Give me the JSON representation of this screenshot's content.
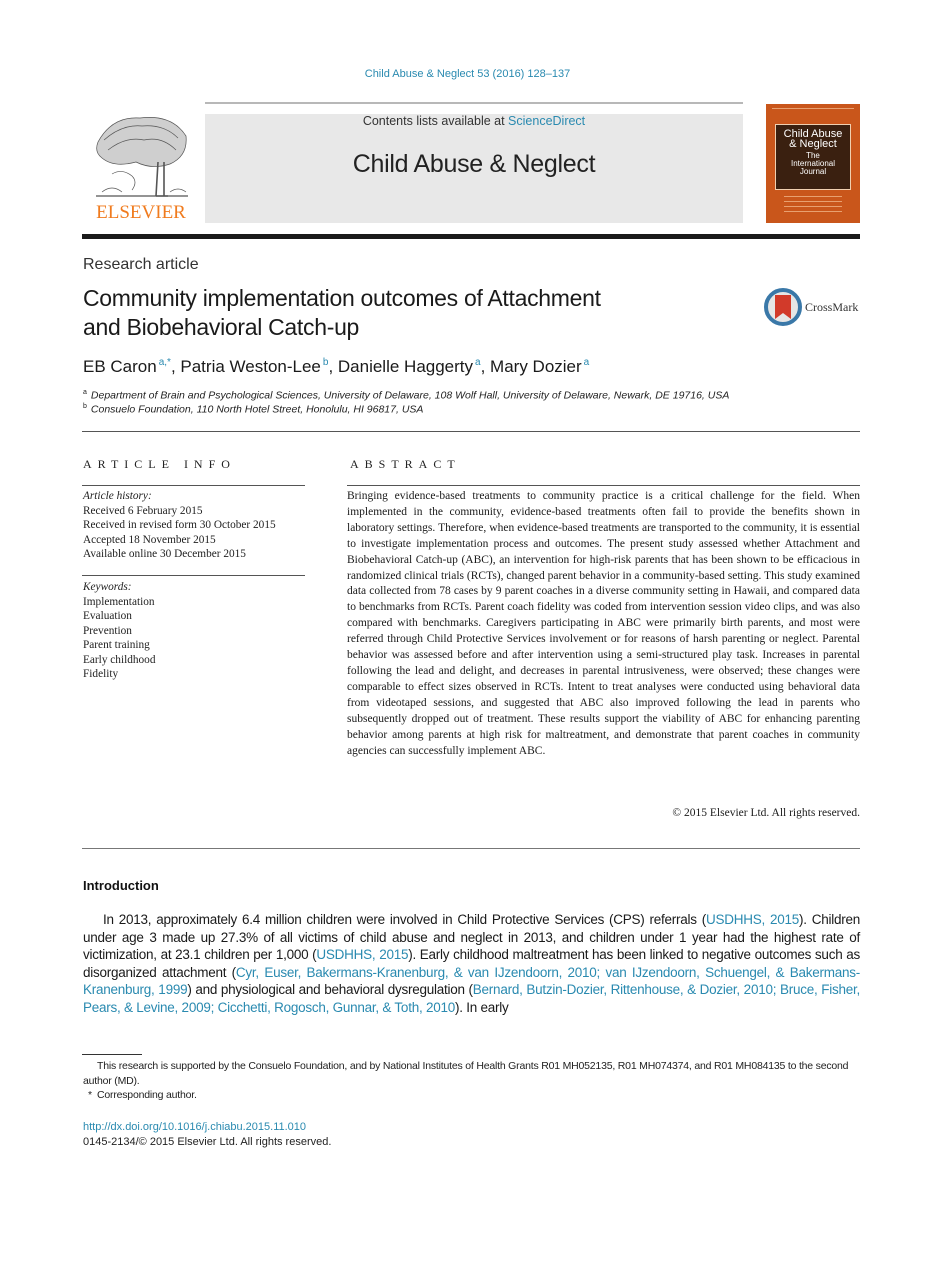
{
  "journal_ref": "Child Abuse & Neglect 53 (2016) 128–137",
  "masthead": {
    "contents_prefix": "Contents lists available at ",
    "contents_link": "ScienceDirect",
    "journal_title": "Child Abuse & Neglect",
    "publisher_logo_text": "ELSEVIER"
  },
  "cover": {
    "line1": "Child Abuse",
    "line2": "& Neglect",
    "line3": "The",
    "line4": "International",
    "line5": "Journal",
    "color": "#c9561b"
  },
  "article": {
    "type": "Research article",
    "title_line1": "Community implementation outcomes of Attachment",
    "title_line2": "and Biobehavioral Catch-up",
    "crossmark_label": "CrossMark",
    "authors": [
      {
        "name": "EB Caron",
        "sup": "a,*"
      },
      {
        "name": "Patria Weston-Lee",
        "sup": "b"
      },
      {
        "name": "Danielle Haggerty",
        "sup": "a"
      },
      {
        "name": "Mary Dozier",
        "sup": "a"
      }
    ],
    "affiliations": [
      {
        "mark": "a",
        "text": "Department of Brain and Psychological Sciences, University of Delaware, 108 Wolf Hall, University of Delaware, Newark, DE 19716, USA"
      },
      {
        "mark": "b",
        "text": "Consuelo Foundation, 110 North Hotel Street, Honolulu, HI 96817, USA"
      }
    ]
  },
  "article_info": {
    "heading": "ARTICLE INFO",
    "history_label": "Article history:",
    "history": [
      "Received 6 February 2015",
      "Received in revised form 30 October 2015",
      "Accepted 18 November 2015",
      "Available online 30 December 2015"
    ],
    "keywords_label": "Keywords:",
    "keywords": [
      "Implementation",
      "Evaluation",
      "Prevention",
      "Parent training",
      "Early childhood",
      "Fidelity"
    ]
  },
  "abstract": {
    "heading": "ABSTRACT",
    "text": "Bringing evidence-based treatments to community practice is a critical challenge for the field. When implemented in the community, evidence-based treatments often fail to provide the benefits shown in laboratory settings. Therefore, when evidence-based treatments are transported to the community, it is essential to investigate implementation process and outcomes. The present study assessed whether Attachment and Biobehavioral Catch-up (ABC), an intervention for high-risk parents that has been shown to be efficacious in randomized clinical trials (RCTs), changed parent behavior in a community-based setting. This study examined data collected from 78 cases by 9 parent coaches in a diverse community setting in Hawaii, and compared data to benchmarks from RCTs. Parent coach fidelity was coded from intervention session video clips, and was also compared with benchmarks. Caregivers participating in ABC were primarily birth parents, and most were referred through Child Protective Services involvement or for reasons of harsh parenting or neglect. Parental behavior was assessed before and after intervention using a semi-structured play task. Increases in parental following the lead and delight, and decreases in parental intrusiveness, were observed; these changes were comparable to effect sizes observed in RCTs. Intent to treat analyses were conducted using behavioral data from videotaped sessions, and suggested that ABC also improved following the lead in parents who subsequently dropped out of treatment. These results support the viability of ABC for enhancing parenting behavior among parents at high risk for maltreatment, and demonstrate that parent coaches in community agencies can successfully implement ABC.",
    "copyright": "© 2015 Elsevier Ltd. All rights reserved."
  },
  "introduction": {
    "heading": "Introduction",
    "segments": [
      {
        "t": "In 2013, approximately 6.4 million children were involved in Child Protective Services (CPS) referrals (",
        "link": false
      },
      {
        "t": "USDHHS, 2015",
        "link": true
      },
      {
        "t": "). Children under age 3 made up 27.3% of all victims of child abuse and neglect in 2013, and children under 1 year had the highest rate of victimization, at 23.1 children per 1,000 (",
        "link": false
      },
      {
        "t": "USDHHS, 2015",
        "link": true
      },
      {
        "t": "). Early childhood maltreatment has been linked to negative outcomes such as disorganized attachment (",
        "link": false
      },
      {
        "t": "Cyr, Euser, Bakermans-Kranenburg, & van IJzendoorn, 2010; van IJzendoorn, Schuengel, & Bakermans-Kranenburg, 1999",
        "link": true
      },
      {
        "t": ") and physiological and behavioral dysregulation (",
        "link": false
      },
      {
        "t": "Bernard, Butzin-Dozier, Rittenhouse, & Dozier, 2010; Bruce, Fisher, Pears, & Levine, 2009; Cicchetti, Rogosch, Gunnar, & Toth, 2010",
        "link": true
      },
      {
        "t": "). In early",
        "link": false
      }
    ]
  },
  "footnotes": {
    "funding": "This research is supported by the Consuelo Foundation, and by National Institutes of Health Grants R01 MH052135, R01 MH074374, and R01 MH084135 to the second author (MD).",
    "corresponding_mark": "*",
    "corresponding": "Corresponding author.",
    "doi": "http://dx.doi.org/10.1016/j.chiabu.2015.11.010",
    "issn": "0145-2134/© 2015 Elsevier Ltd. All rights reserved."
  },
  "colors": {
    "link": "#2a8ab0",
    "elsevier_orange": "#f07b1e",
    "masthead_bg": "#e8e8e8"
  }
}
